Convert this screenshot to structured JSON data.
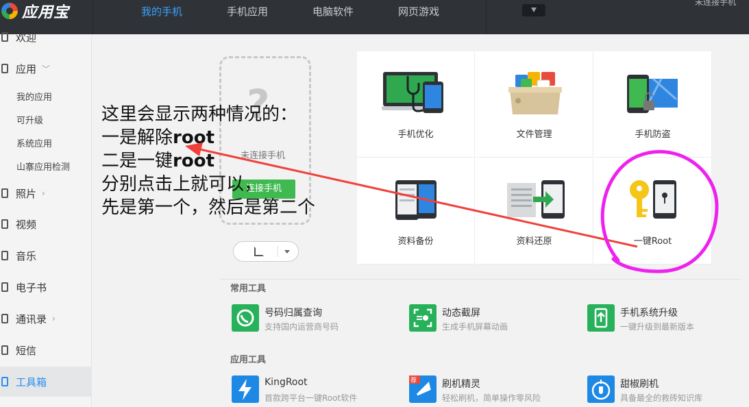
{
  "app": {
    "title": "应用宝",
    "account_text": "未连接手机"
  },
  "topnav": {
    "items": [
      "我的手机",
      "手机应用",
      "电脑软件",
      "网页游戏"
    ],
    "active_index": 0
  },
  "sidebar": {
    "items": [
      {
        "label": "欢迎",
        "icon": "home-icon"
      },
      {
        "label": "应用",
        "icon": "apps-icon",
        "chevron": "﹀"
      },
      {
        "label": "照片",
        "icon": "photo-icon",
        "chevron": "›"
      },
      {
        "label": "视频",
        "icon": "video-icon"
      },
      {
        "label": "音乐",
        "icon": "music-icon"
      },
      {
        "label": "电子书",
        "icon": "ebook-icon"
      },
      {
        "label": "通讯录",
        "icon": "contacts-icon",
        "chevron": "›"
      },
      {
        "label": "短信",
        "icon": "sms-icon"
      },
      {
        "label": "工具箱",
        "icon": "toolbox-icon",
        "active": true
      }
    ],
    "sub_items": [
      "我的应用",
      "可升级",
      "系统应用",
      "山寨应用检测"
    ]
  },
  "phone": {
    "status": "未连接手机",
    "placeholder_glyph": "?",
    "connect_label": "连接手机"
  },
  "tool_grid": [
    {
      "label": "手机优化",
      "icon": "phone-optimize-icon"
    },
    {
      "label": "文件管理",
      "icon": "file-manager-icon"
    },
    {
      "label": "手机防盗",
      "icon": "anti-theft-icon"
    },
    {
      "label": "资料备份",
      "icon": "backup-icon"
    },
    {
      "label": "资料还原",
      "icon": "restore-icon"
    },
    {
      "label": "一键Root",
      "icon": "root-key-icon"
    }
  ],
  "common_tools": {
    "title": "常用工具",
    "items": [
      {
        "name": "号码归属查询",
        "desc": "支持国内运营商号码",
        "icon": "phone-lookup-icon",
        "color": "#27b15b"
      },
      {
        "name": "动态截屏",
        "desc": "生成手机屏幕动画",
        "icon": "screen-capture-icon",
        "color": "#27b15b"
      },
      {
        "name": "手机系统升级",
        "desc": "一键升级到最新版本",
        "icon": "system-upgrade-icon",
        "color": "#27b15b"
      }
    ]
  },
  "app_tools": {
    "title": "应用工具",
    "items": [
      {
        "name": "KingRoot",
        "desc": "首款跨平台一键Root软件",
        "icon": "kingroot-icon",
        "color": "#1e88e5"
      },
      {
        "name": "刷机精灵",
        "desc": "轻松刷机，简单操作零风险",
        "icon": "flash-wizard-icon",
        "color": "#1e88e5",
        "badge": "荐"
      },
      {
        "name": "甜椒刷机",
        "desc": "具备最全的救砖知识库",
        "icon": "sweet-pepper-icon",
        "color": "#1e88e5"
      }
    ]
  },
  "annotation": {
    "lines": [
      "这里会显示两种情况的：",
      "一是解除",
      "root",
      "二是一键",
      "root",
      "分别点击上就可以，",
      "先是第一个，然后是第二个"
    ]
  },
  "colors": {
    "accent": "#2b8ef0",
    "topbar": "#2f3338",
    "green": "#3fb950",
    "arrow": "#f0403c",
    "highlight": "#ee22ee"
  }
}
